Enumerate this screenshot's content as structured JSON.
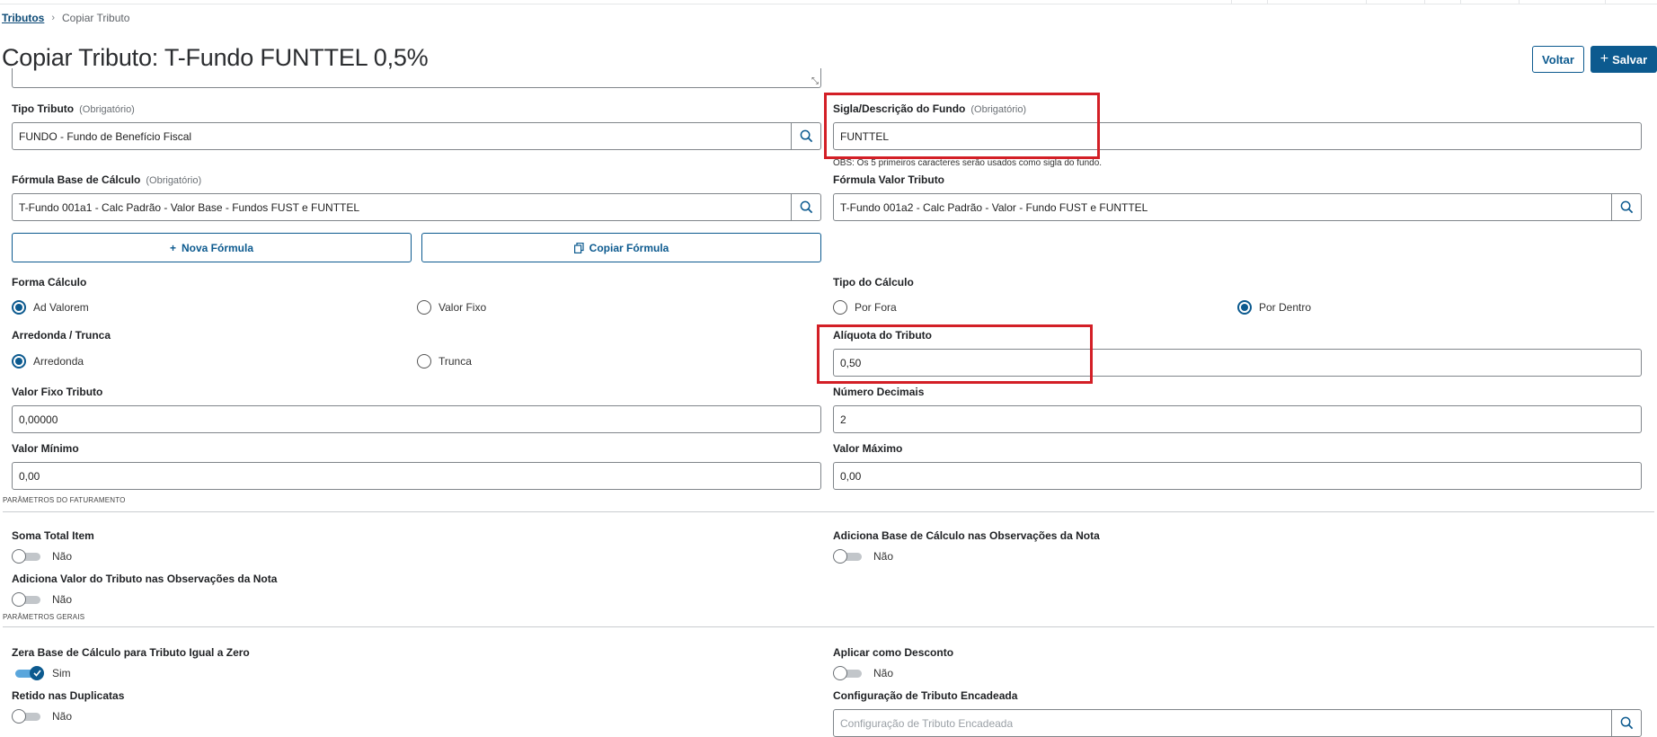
{
  "breadcrumb": {
    "root": "Tributos",
    "current": "Copiar Tributo"
  },
  "page": {
    "title": "Copiar Tributo: T-Fundo FUNTTEL 0,5%"
  },
  "actions": {
    "back_label": "Voltar",
    "save_label": "Salvar"
  },
  "colors": {
    "primary": "#0c5a8f",
    "highlight": "#d31f26",
    "toggle_on_track": "#5aa6dc"
  },
  "required_tag": "(Obrigatório)",
  "tipo_tributo": {
    "label": "Tipo Tributo",
    "value": "FUNDO - Fundo de Benefício Fiscal"
  },
  "sigla_fundo": {
    "label": "Sigla/Descrição do Fundo",
    "value": "FUNTTEL",
    "note": "OBS: Os 5 primeiros caracteres serão usados como sigla do fundo."
  },
  "formula_base": {
    "label": "Fórmula Base de Cálculo",
    "value": "T-Fundo 001a1 - Calc Padrão - Valor Base - Fundos FUST e FUNTTEL"
  },
  "formula_valor": {
    "label": "Fórmula Valor Tributo",
    "value": "T-Fundo 001a2 - Calc Padrão - Valor - Fundo FUST e FUNTTEL"
  },
  "buttons": {
    "nova_formula": "Nova Fórmula",
    "copiar_formula": "Copiar Fórmula"
  },
  "forma_calculo": {
    "label": "Forma Cálculo",
    "options": [
      "Ad Valorem",
      "Valor Fixo"
    ],
    "selected": "Ad Valorem"
  },
  "tipo_calculo": {
    "label": "Tipo do Cálculo",
    "options": [
      "Por Fora",
      "Por Dentro"
    ],
    "selected": "Por Dentro"
  },
  "arredonda": {
    "label": "Arredonda / Trunca",
    "options": [
      "Arredonda",
      "Trunca"
    ],
    "selected": "Arredonda"
  },
  "aliquota": {
    "label": "Alíquota do Tributo",
    "value": "0,50"
  },
  "valor_fixo": {
    "label": "Valor Fixo Tributo",
    "value": "0,00000"
  },
  "numero_decimais": {
    "label": "Número Decimais",
    "value": "2"
  },
  "valor_minimo": {
    "label": "Valor Mínimo",
    "value": "0,00"
  },
  "valor_maximo": {
    "label": "Valor Máximo",
    "value": "0,00"
  },
  "section_faturamento": "PARÂMETROS DO FATURAMENTO",
  "soma_total_item": {
    "label": "Soma Total Item",
    "state": "Não"
  },
  "adiciona_base_obs": {
    "label": "Adiciona Base de Cálculo nas Observações da Nota",
    "state": "Não"
  },
  "adiciona_valor_obs": {
    "label": "Adiciona Valor do Tributo nas Observações da Nota",
    "state": "Não"
  },
  "section_gerais": "PARÂMETROS GERAIS",
  "zera_base": {
    "label": "Zera Base de Cálculo para Tributo Igual a Zero",
    "state": "Sim"
  },
  "aplicar_desconto": {
    "label": "Aplicar como Desconto",
    "state": "Não"
  },
  "retido_duplicatas": {
    "label": "Retido nas Duplicatas",
    "state": "Não"
  },
  "config_encadeada": {
    "label": "Configuração de Tributo Encadeada",
    "placeholder": "Configuração de Tributo Encadeada"
  }
}
